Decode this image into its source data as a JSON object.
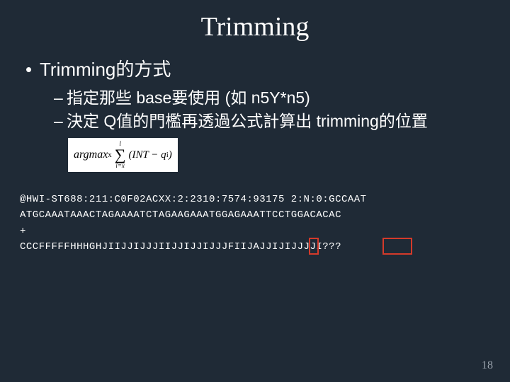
{
  "title": "Trimming",
  "bullets": {
    "b1": "Trimming的方式",
    "b2a": "指定那些 base要使用 (如 n5Y*n5)",
    "b2b": "決定 Q值的門檻再透過公式計算出 trimming的位置"
  },
  "formula": {
    "argmax": "argmax",
    "sub_x": "x",
    "sigma_top": "l",
    "sigma_bot": "i=x",
    "body": "(INT − q",
    "sub_i": "i",
    "close": ")"
  },
  "fastq": {
    "line1": "@HWI-ST688:211:C0F02ACXX:2:2310:7574:93175 2:N:0:GCCAAT",
    "line2": "ATGCAAATAAACTAGAAAATCTAGAAGAAATGGAGAAATTCCTGGACACAC",
    "line3": "+",
    "line4": "CCCFFFFFHHHGHJIIJJIJJJIIJJIJJIJJJFIIJAJJIJIJJJJI???"
  },
  "page_number": "18"
}
